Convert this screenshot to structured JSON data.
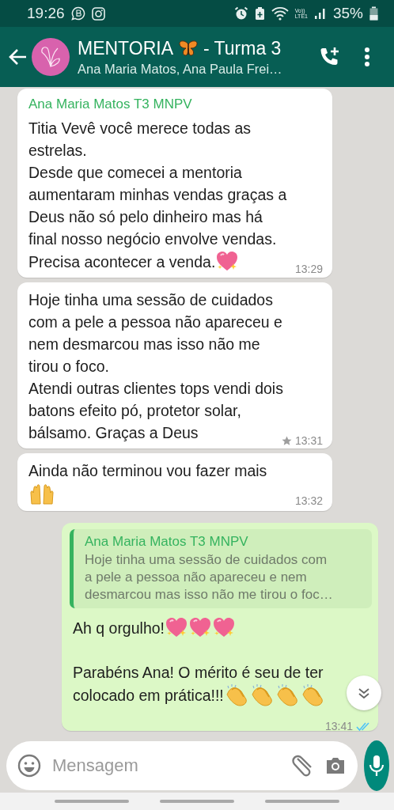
{
  "status_bar": {
    "time": "19:26",
    "volte_label": "Vo))",
    "lte_label": "LTE1",
    "battery": "35%"
  },
  "header": {
    "title_before": "MENTORIA",
    "title_after": "- Turma 3",
    "subtitle": "Ana Maria Matos, Ana Paula Frei…"
  },
  "messages": [
    {
      "kind": "incoming",
      "sender": "Ana Maria Matos T3 MNPV",
      "paragraphs": [
        {
          "lines": [
            {
              "text": "Titia Vevê você merece todas as\nestrelas.\nDesde que comecei a mentoria\naumentaram minhas vendas graças a\nDeus não só pelo dinheiro mas há\nfinal nosso negócio envolve vendas."
            },
            {
              "text": "Precisa acontecer a venda.",
              "emojis": [
                {
                  "kind": "sparkling_heart"
                }
              ]
            }
          ]
        }
      ],
      "time": "13:29",
      "starred": false
    },
    {
      "kind": "incoming",
      "paragraphs": [
        {
          "lines": [
            {
              "text": "Hoje tinha uma sessão de cuidados\ncom a pele a pessoa não apareceu e\nnem desmarcou mas isso não me\ntirou o foco.\nAtendi outras clientes tops vendi dois\nbatons efeito pó, protetor solar,\nbálsamo. Graças a Deus"
            }
          ]
        }
      ],
      "time": "13:31",
      "starred": true
    },
    {
      "kind": "incoming",
      "paragraphs": [
        {
          "lines": [
            {
              "text": "Ainda não terminou vou fazer mais"
            },
            {
              "emojis": [
                {
                  "kind": "raised_hands"
                }
              ]
            }
          ]
        }
      ],
      "time": "13:32",
      "starred": false
    },
    {
      "kind": "outgoing",
      "quote": {
        "sender": "Ana Maria Matos T3 MNPV",
        "text": "Hoje tinha uma sessão de cuidados com\na pele a pessoa não apareceu e nem\ndesmarcou mas isso não me tirou o foc…"
      },
      "paragraphs": [
        {
          "lines": [
            {
              "text": "Ah q orgulho!",
              "emojis": [
                {
                  "kind": "sparkling_heart"
                },
                {
                  "kind": "sparkling_heart"
                },
                {
                  "kind": "sparkling_heart"
                }
              ]
            }
          ]
        },
        {
          "lines": [
            {
              "text": "Parabéns Ana! O mérito é seu de ter"
            },
            {
              "text": "colocado em prática!!!",
              "emojis": [
                {
                  "kind": "clapping_hands"
                },
                {
                  "kind": "clapping_hands"
                },
                {
                  "kind": "clapping_hands"
                },
                {
                  "kind": "clapping_hands"
                }
              ]
            }
          ]
        }
      ],
      "time": "13:41",
      "read": true,
      "starred": false
    }
  ],
  "input": {
    "placeholder": "Mensagem"
  }
}
